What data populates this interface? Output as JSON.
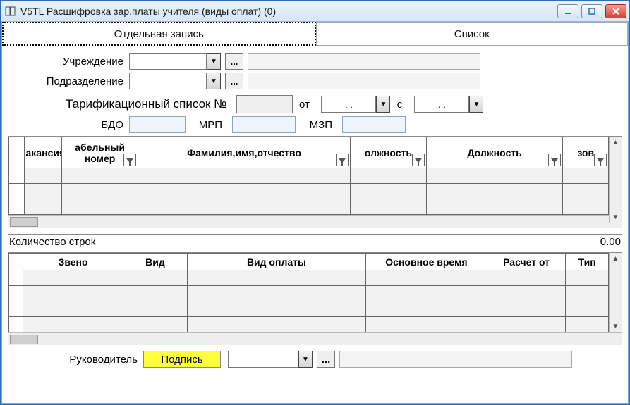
{
  "window": {
    "title": "V5TL Расшифровка зар.платы учителя (виды оплат) (0)"
  },
  "tabs": {
    "single": "Отдельная запись",
    "list": "Список"
  },
  "form": {
    "institution_label": "Учреждение",
    "division_label": "Подразделение",
    "tariff_label": "Тарификационный список №",
    "from_label": "от",
    "date1": " .  . ",
    "s_label": "с",
    "date2": " .  . ",
    "bdo_label": "БДО",
    "mrp_label": "МРП",
    "mzp_label": "МЗП"
  },
  "grid1": {
    "headers": [
      "акансия",
      "абельный номер",
      "Фамилия,имя,отчество",
      "олжность",
      "Должность",
      "зов"
    ]
  },
  "rowcount_label": "Количество строк",
  "rowcount_value": "0.00",
  "grid2": {
    "headers": [
      "Звено",
      "Вид",
      "Вид оплаты",
      "Основное время",
      "Расчет от",
      "Тип"
    ]
  },
  "footer": {
    "leader_label": "Руководитель",
    "sign_label": "Подпись"
  },
  "ellipsis": "..."
}
